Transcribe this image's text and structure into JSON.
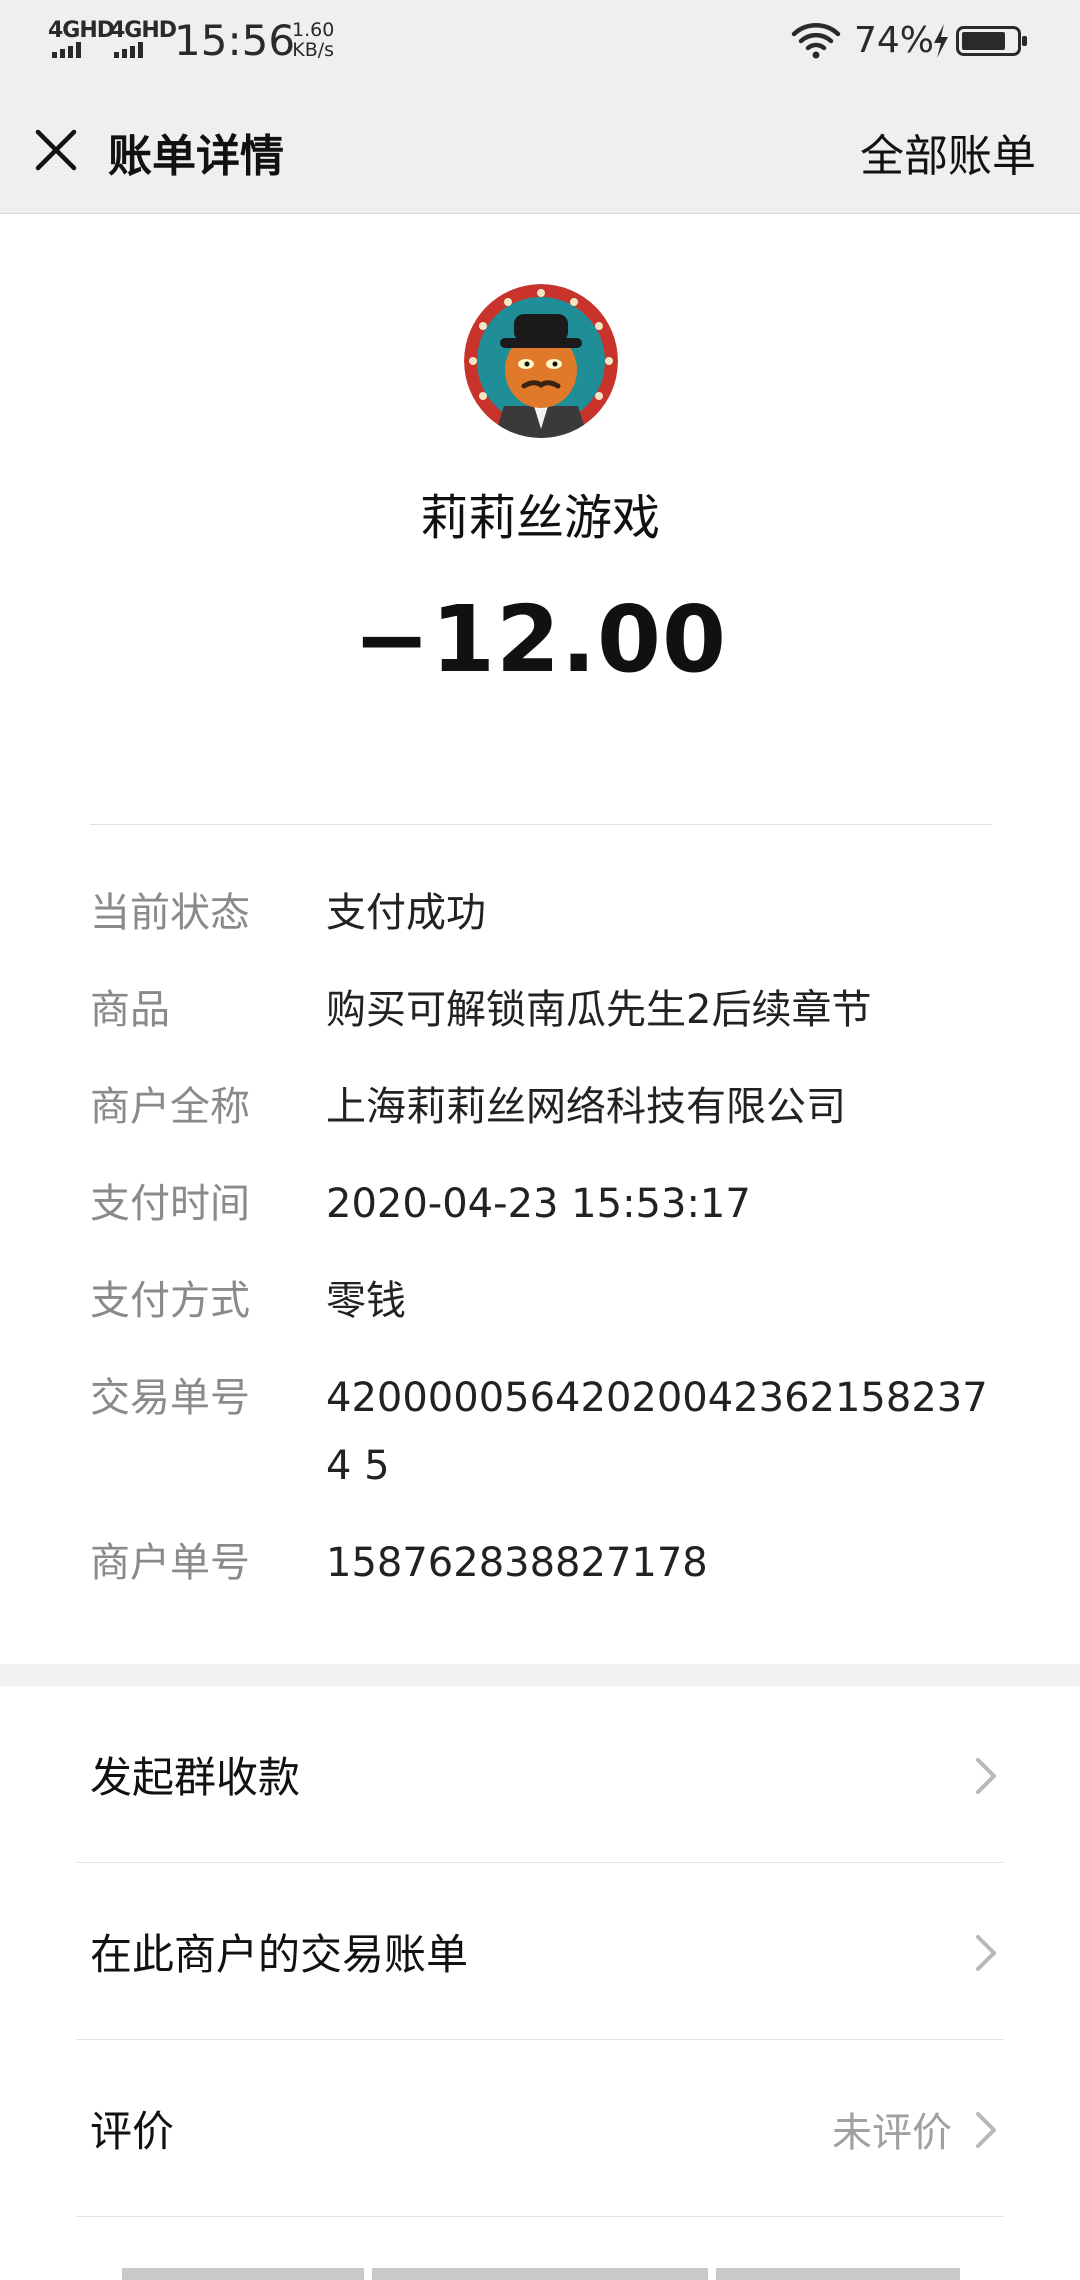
{
  "status_bar": {
    "network_1": "4GHD",
    "network_2": "4GHD",
    "time": "15:56",
    "speed_value": "1.60",
    "speed_unit": "KB/s",
    "battery_percent": "74%",
    "icons": [
      "signal-icon",
      "wifi-icon",
      "charging-bolt-icon",
      "battery-icon"
    ]
  },
  "nav": {
    "title": "账单详情",
    "right_link": "全部账单",
    "close_icon": "close-icon"
  },
  "header": {
    "merchant_name": "莉莉丝游戏",
    "amount": "−12.00"
  },
  "details": [
    {
      "label": "当前状态",
      "value": "支付成功"
    },
    {
      "label": "商品",
      "value": "购买可解锁南瓜先生2后续章节"
    },
    {
      "label": "商户全称",
      "value": "上海莉莉丝网络科技有限公司"
    },
    {
      "label": "支付时间",
      "value": "2020-04-23 15:53:17"
    },
    {
      "label": "支付方式",
      "value": "零钱"
    },
    {
      "label": "交易单号",
      "value": "420000056420200423621582374 5"
    },
    {
      "label": "商户单号",
      "value": "158762838827178"
    }
  ],
  "actions": [
    {
      "label": "发起群收款",
      "hint": ""
    },
    {
      "label": "在此商户的交易账单",
      "hint": ""
    },
    {
      "label": "评价",
      "hint": "未评价"
    }
  ],
  "colors": {
    "bar_bg": "#efefef",
    "label_gray": "#8a8a8a",
    "hint_gray": "#a0a0a0"
  }
}
